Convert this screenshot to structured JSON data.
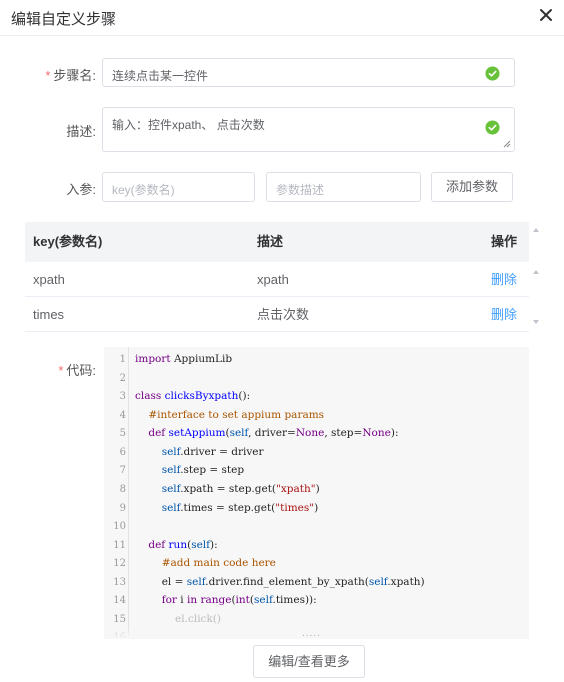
{
  "dialog": {
    "title": "编辑自定义步骤"
  },
  "form": {
    "step_name": {
      "required_mark": "*",
      "label": "步骤名:",
      "value": "连续点击某一控件"
    },
    "description": {
      "label": "描述:",
      "value": "输入：控件xpath、 点击次数"
    },
    "params": {
      "label": "入参:",
      "key_placeholder": "key(参数名)",
      "desc_placeholder": "参数描述",
      "add_button": "添加参数"
    },
    "code": {
      "required_mark": "*",
      "label": "代码:"
    }
  },
  "params_table": {
    "columns": [
      "key(参数名)",
      "描述",
      "操作"
    ],
    "rows": [
      {
        "key": "xpath",
        "desc": "xpath",
        "action": "删除"
      },
      {
        "key": "times",
        "desc": "点击次数",
        "action": "删除"
      }
    ]
  },
  "code_editor": {
    "line_numbers": [
      "1",
      "2",
      "3",
      "4",
      "5",
      "6",
      "7",
      "8",
      "9",
      "10",
      "11",
      "12",
      "13",
      "14",
      "15",
      "16"
    ],
    "lines": [
      "import AppiumLib",
      "",
      "class clicksByxpath():",
      "    #interface to set appium params",
      "    def setAppium(self, driver=None, step=None):",
      "        self.driver = driver",
      "        self.step = step",
      "        self.xpath = step.get(\"xpath\")",
      "        self.times = step.get(\"times\")",
      "",
      "    def run(self):",
      "        #add main code here",
      "        el = self.driver.find_element_by_xpath(self.xpath)",
      "        for i in range(int(self.times)):",
      "            el.click()",
      ""
    ],
    "ellipsis": "....."
  },
  "footer": {
    "more_button": "编辑/查看更多"
  },
  "colors": {
    "required": "#f56c6c",
    "success": "#67c23a",
    "link": "#409eff",
    "table_header_bg": "#f3f4f6",
    "code_bg": "#f7f7f7"
  },
  "icons": [
    "close-icon",
    "check-circle-icon",
    "resize-handle-icon",
    "scroll-up-arrow-icon",
    "scroll-down-arrow-icon"
  ]
}
